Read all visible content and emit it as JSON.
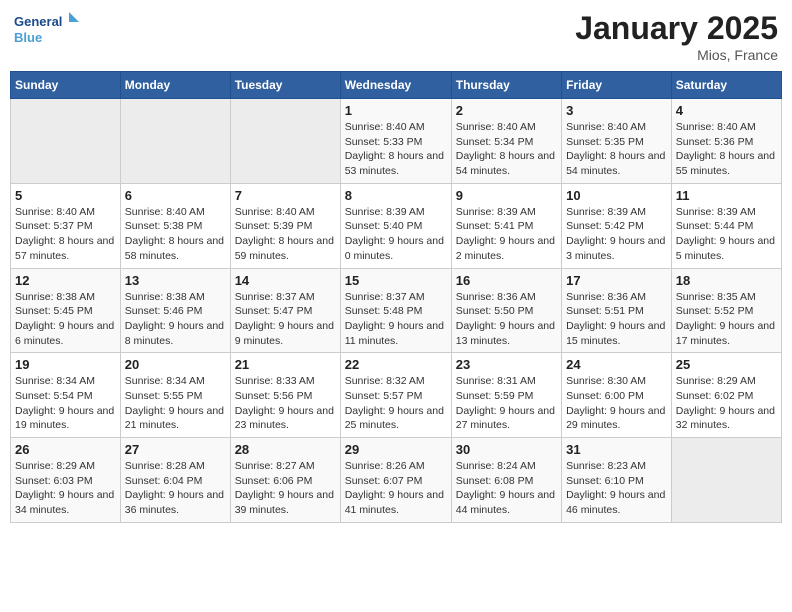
{
  "logo": {
    "line1": "General",
    "line2": "Blue"
  },
  "title": "January 2025",
  "location": "Mios, France",
  "weekdays": [
    "Sunday",
    "Monday",
    "Tuesday",
    "Wednesday",
    "Thursday",
    "Friday",
    "Saturday"
  ],
  "weeks": [
    [
      {
        "day": "",
        "detail": ""
      },
      {
        "day": "",
        "detail": ""
      },
      {
        "day": "",
        "detail": ""
      },
      {
        "day": "1",
        "detail": "Sunrise: 8:40 AM\nSunset: 5:33 PM\nDaylight: 8 hours\nand 53 minutes."
      },
      {
        "day": "2",
        "detail": "Sunrise: 8:40 AM\nSunset: 5:34 PM\nDaylight: 8 hours\nand 54 minutes."
      },
      {
        "day": "3",
        "detail": "Sunrise: 8:40 AM\nSunset: 5:35 PM\nDaylight: 8 hours\nand 54 minutes."
      },
      {
        "day": "4",
        "detail": "Sunrise: 8:40 AM\nSunset: 5:36 PM\nDaylight: 8 hours\nand 55 minutes."
      }
    ],
    [
      {
        "day": "5",
        "detail": "Sunrise: 8:40 AM\nSunset: 5:37 PM\nDaylight: 8 hours\nand 57 minutes."
      },
      {
        "day": "6",
        "detail": "Sunrise: 8:40 AM\nSunset: 5:38 PM\nDaylight: 8 hours\nand 58 minutes."
      },
      {
        "day": "7",
        "detail": "Sunrise: 8:40 AM\nSunset: 5:39 PM\nDaylight: 8 hours\nand 59 minutes."
      },
      {
        "day": "8",
        "detail": "Sunrise: 8:39 AM\nSunset: 5:40 PM\nDaylight: 9 hours\nand 0 minutes."
      },
      {
        "day": "9",
        "detail": "Sunrise: 8:39 AM\nSunset: 5:41 PM\nDaylight: 9 hours\nand 2 minutes."
      },
      {
        "day": "10",
        "detail": "Sunrise: 8:39 AM\nSunset: 5:42 PM\nDaylight: 9 hours\nand 3 minutes."
      },
      {
        "day": "11",
        "detail": "Sunrise: 8:39 AM\nSunset: 5:44 PM\nDaylight: 9 hours\nand 5 minutes."
      }
    ],
    [
      {
        "day": "12",
        "detail": "Sunrise: 8:38 AM\nSunset: 5:45 PM\nDaylight: 9 hours\nand 6 minutes."
      },
      {
        "day": "13",
        "detail": "Sunrise: 8:38 AM\nSunset: 5:46 PM\nDaylight: 9 hours\nand 8 minutes."
      },
      {
        "day": "14",
        "detail": "Sunrise: 8:37 AM\nSunset: 5:47 PM\nDaylight: 9 hours\nand 9 minutes."
      },
      {
        "day": "15",
        "detail": "Sunrise: 8:37 AM\nSunset: 5:48 PM\nDaylight: 9 hours\nand 11 minutes."
      },
      {
        "day": "16",
        "detail": "Sunrise: 8:36 AM\nSunset: 5:50 PM\nDaylight: 9 hours\nand 13 minutes."
      },
      {
        "day": "17",
        "detail": "Sunrise: 8:36 AM\nSunset: 5:51 PM\nDaylight: 9 hours\nand 15 minutes."
      },
      {
        "day": "18",
        "detail": "Sunrise: 8:35 AM\nSunset: 5:52 PM\nDaylight: 9 hours\nand 17 minutes."
      }
    ],
    [
      {
        "day": "19",
        "detail": "Sunrise: 8:34 AM\nSunset: 5:54 PM\nDaylight: 9 hours\nand 19 minutes."
      },
      {
        "day": "20",
        "detail": "Sunrise: 8:34 AM\nSunset: 5:55 PM\nDaylight: 9 hours\nand 21 minutes."
      },
      {
        "day": "21",
        "detail": "Sunrise: 8:33 AM\nSunset: 5:56 PM\nDaylight: 9 hours\nand 23 minutes."
      },
      {
        "day": "22",
        "detail": "Sunrise: 8:32 AM\nSunset: 5:57 PM\nDaylight: 9 hours\nand 25 minutes."
      },
      {
        "day": "23",
        "detail": "Sunrise: 8:31 AM\nSunset: 5:59 PM\nDaylight: 9 hours\nand 27 minutes."
      },
      {
        "day": "24",
        "detail": "Sunrise: 8:30 AM\nSunset: 6:00 PM\nDaylight: 9 hours\nand 29 minutes."
      },
      {
        "day": "25",
        "detail": "Sunrise: 8:29 AM\nSunset: 6:02 PM\nDaylight: 9 hours\nand 32 minutes."
      }
    ],
    [
      {
        "day": "26",
        "detail": "Sunrise: 8:29 AM\nSunset: 6:03 PM\nDaylight: 9 hours\nand 34 minutes."
      },
      {
        "day": "27",
        "detail": "Sunrise: 8:28 AM\nSunset: 6:04 PM\nDaylight: 9 hours\nand 36 minutes."
      },
      {
        "day": "28",
        "detail": "Sunrise: 8:27 AM\nSunset: 6:06 PM\nDaylight: 9 hours\nand 39 minutes."
      },
      {
        "day": "29",
        "detail": "Sunrise: 8:26 AM\nSunset: 6:07 PM\nDaylight: 9 hours\nand 41 minutes."
      },
      {
        "day": "30",
        "detail": "Sunrise: 8:24 AM\nSunset: 6:08 PM\nDaylight: 9 hours\nand 44 minutes."
      },
      {
        "day": "31",
        "detail": "Sunrise: 8:23 AM\nSunset: 6:10 PM\nDaylight: 9 hours\nand 46 minutes."
      },
      {
        "day": "",
        "detail": ""
      }
    ]
  ]
}
